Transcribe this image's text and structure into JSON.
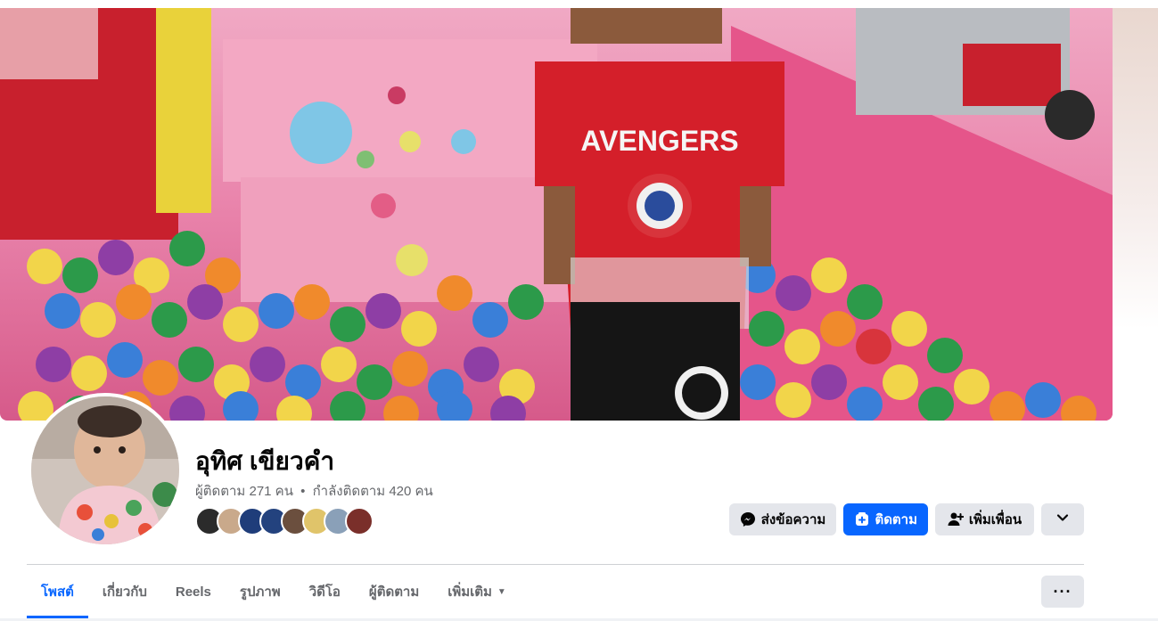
{
  "profile": {
    "name": "อุทิศ เขียวคำ",
    "followers": "ผู้ติดตาม 271 คน",
    "separator": "•",
    "following": "กำลังติดตาม 420 คน"
  },
  "friends_preview": {
    "colors": [
      "#2b2b2b",
      "#c9a98b",
      "#1f3d7a",
      "#23427e",
      "#6b4f3e",
      "#e0c46a",
      "#8aa0b8",
      "#7a2f2a"
    ]
  },
  "actions": {
    "message": "ส่งข้อความ",
    "follow": "ติดตาม",
    "add_friend": "เพิ่มเพื่อน"
  },
  "tabs": [
    {
      "label": "โพสต์",
      "active": true
    },
    {
      "label": "เกี่ยวกับ",
      "active": false
    },
    {
      "label": "Reels",
      "active": false
    },
    {
      "label": "รูปภาพ",
      "active": false
    },
    {
      "label": "วิดีโอ",
      "active": false
    },
    {
      "label": "ผู้ติดตาม",
      "active": false
    },
    {
      "label": "เพิ่มเติม",
      "active": false
    }
  ],
  "theme": {
    "accent": "#0866ff",
    "button_gray": "#e4e6eb",
    "secondary_text": "#65676b"
  },
  "icons": {
    "message": "messenger-icon",
    "follow": "follow-icon",
    "add_friend": "add-friend-icon",
    "dropdown": "chevron-down-icon",
    "more": "more-dots-icon",
    "tab_more_caret": "caret-down-icon"
  }
}
